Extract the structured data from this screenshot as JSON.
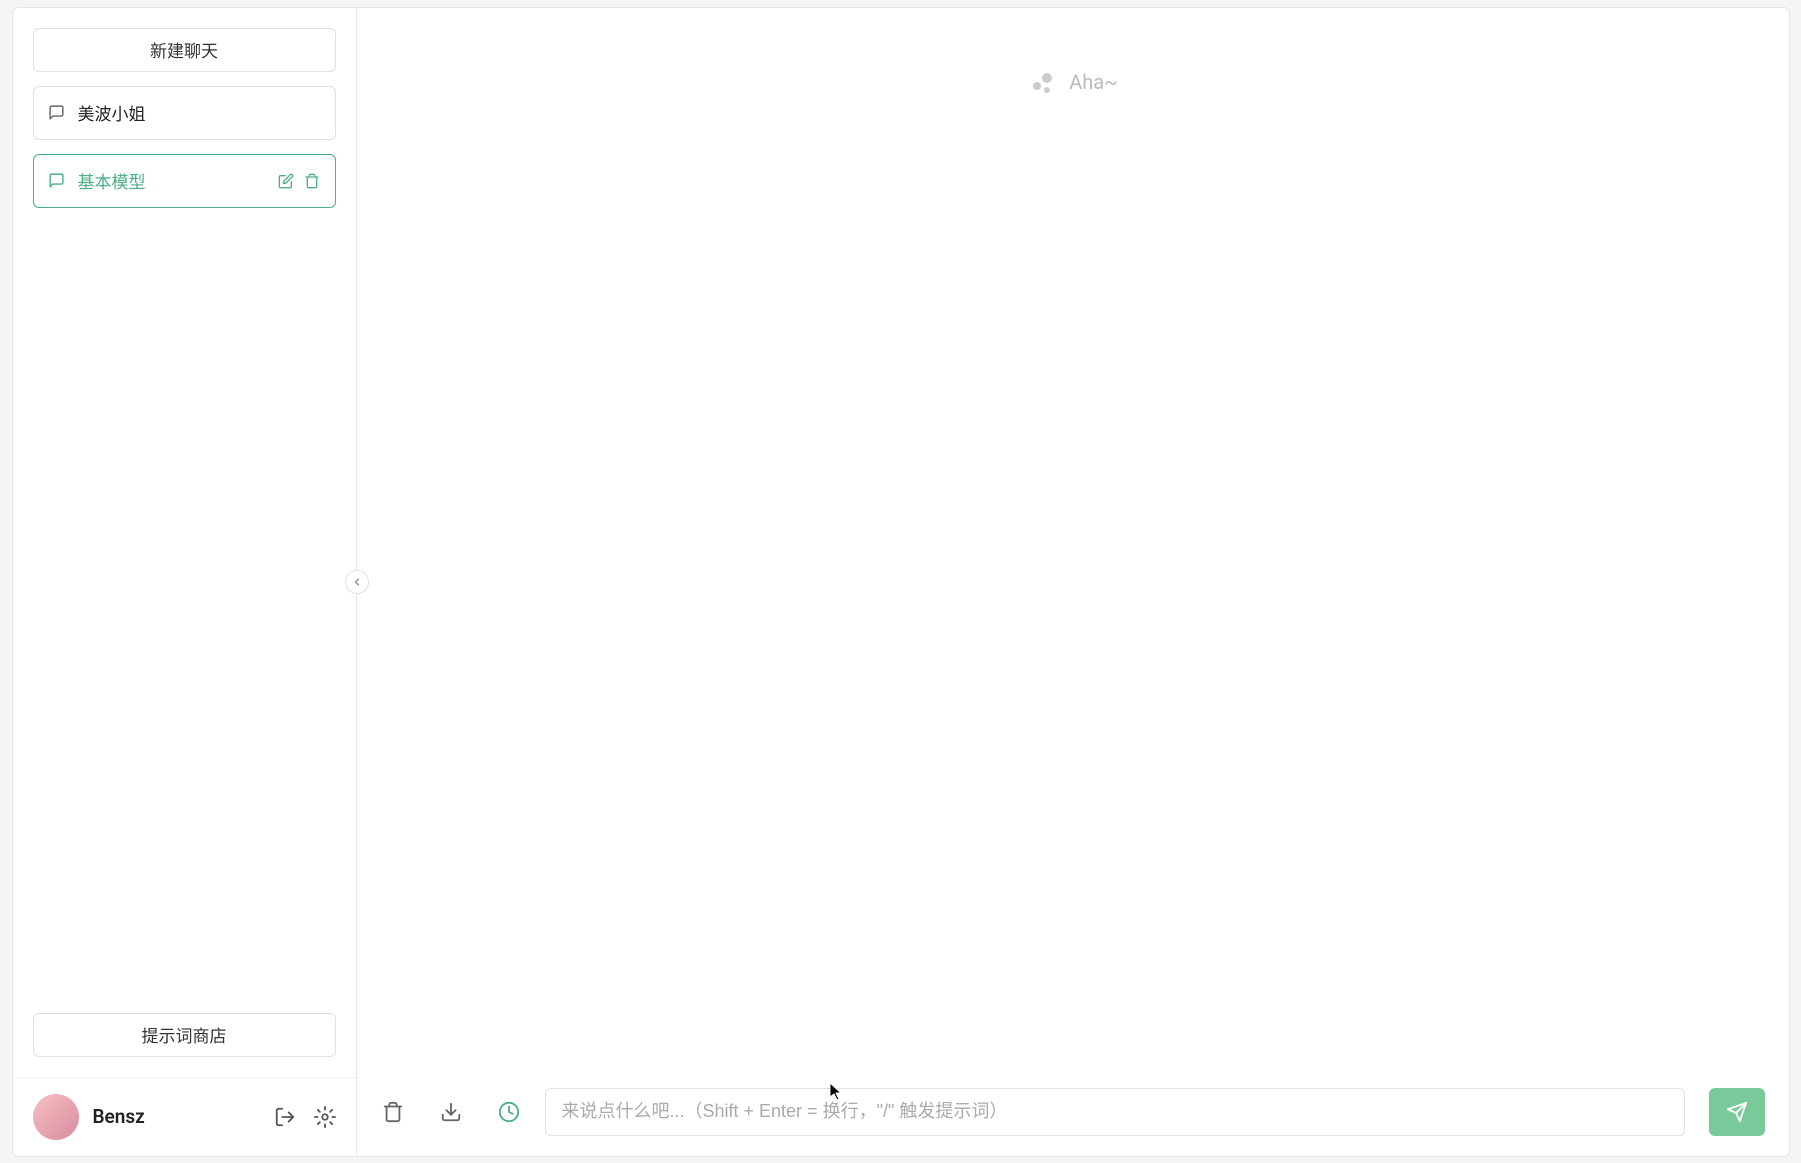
{
  "sidebar": {
    "new_chat_label": "新建聊天",
    "chats": [
      {
        "label": "美波小姐",
        "active": false
      },
      {
        "label": "基本模型",
        "active": true
      }
    ],
    "prompt_store_label": "提示词商店"
  },
  "user": {
    "name": "Bensz"
  },
  "main": {
    "loading_text": "Aha~"
  },
  "footer": {
    "input_placeholder": "来说点什么吧...（Shift + Enter = 换行，\"/\" 触发提示词）"
  },
  "colors": {
    "accent": "#4caf85",
    "send_button": "#7ac99a"
  }
}
